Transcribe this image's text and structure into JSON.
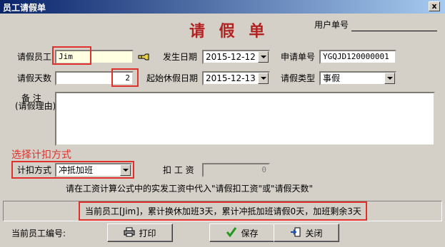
{
  "window": {
    "title": "员工请假单",
    "close_glyph": "x"
  },
  "form": {
    "heading": "请 假 单",
    "order_no_label": "用户单号",
    "employee_label": "请假员工",
    "employee_value": "Jim",
    "days_label": "请假天数",
    "days_value": "2",
    "occur_date_label": "发生日期",
    "occur_date_value": "2015-12-12",
    "start_date_label": "起始休假日期",
    "start_date_value": "2015-12-13",
    "apply_no_label": "申请单号",
    "apply_no_value": "YGQJD120000001",
    "leave_type_label": "请假类型",
    "leave_type_value": "事假",
    "reason_label_1": "备    注",
    "reason_label_2": "(请假理由)",
    "reason_value": "",
    "annotation": "选择计扣方式",
    "deduct_method_label": "计扣方式",
    "deduct_method_value": "冲抵加班",
    "deduct_salary_label": "扣 工 资",
    "deduct_salary_value": "0",
    "hint": "请在工资计算公式中的实发工资中代入\"请假扣工资\"或\"请假天数\""
  },
  "status_text": "当前员工[Jim]，累计换休加班3天，累计冲抵加班请假0天，加班剩余3天",
  "footer": {
    "current_no_label": "当前员工编号:",
    "print_label": "打印",
    "save_label": "保存",
    "close_label": "关闭"
  },
  "colors": {
    "accent": "#b22222",
    "annotation": "#e0302c",
    "titlebar": "#0a246a",
    "highlight_field": "#ffffe1"
  },
  "icons": [
    "close-icon",
    "user-pointer-icon",
    "printer-icon",
    "checkmark-icon",
    "exit-door-icon"
  ]
}
